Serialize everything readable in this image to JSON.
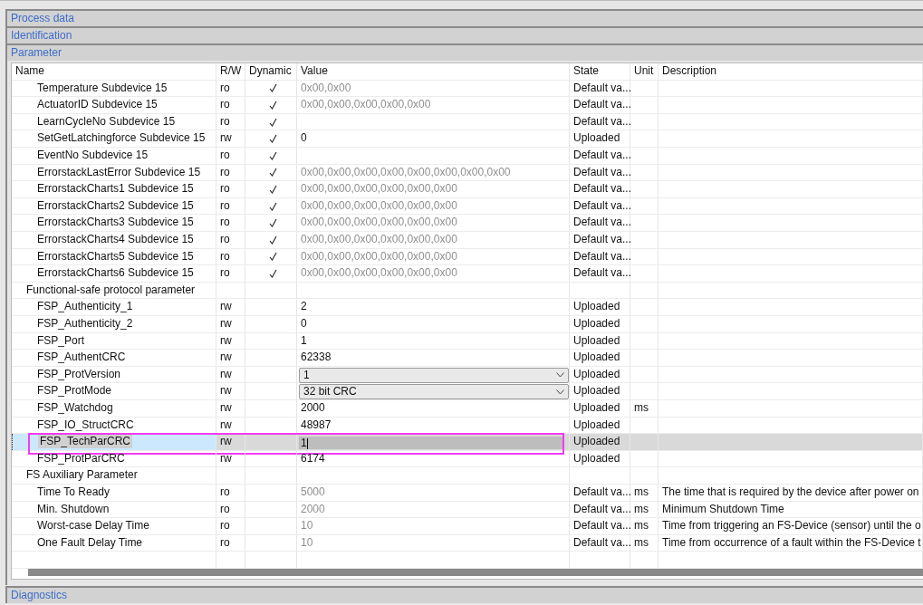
{
  "sections_top": [
    {
      "title": "Process data"
    },
    {
      "title": "Identification"
    },
    {
      "title": "Parameter"
    }
  ],
  "table": {
    "columns": [
      "Name",
      "R/W",
      "Dynamic",
      "Value",
      "State",
      "Unit",
      "Description"
    ],
    "rows": [
      {
        "kind": "param",
        "name": "Temperature Subdevice 15",
        "rw": "ro",
        "dynamic": true,
        "value": {
          "kind": "text",
          "text": "0x00,0x00"
        },
        "greyed": true,
        "state": "Default va...",
        "selected": false,
        "highlighted": false
      },
      {
        "kind": "param",
        "name": "ActuatorID Subdevice 15",
        "rw": "ro",
        "dynamic": true,
        "value": {
          "kind": "text",
          "text": "0x00,0x00,0x00,0x00,0x00"
        },
        "greyed": true,
        "state": "Default va...",
        "selected": false,
        "highlighted": false
      },
      {
        "kind": "param",
        "name": "LearnCycleNo Subdevice 15",
        "rw": "ro",
        "dynamic": true,
        "greyed": true,
        "state": "Default va...",
        "selected": false,
        "highlighted": false
      },
      {
        "kind": "param",
        "name": "SetGetLatchingforce Subdevice 15",
        "rw": "rw",
        "dynamic": true,
        "value": {
          "kind": "text",
          "text": "0"
        },
        "greyed": false,
        "state": "Uploaded",
        "selected": false,
        "highlighted": false
      },
      {
        "kind": "param",
        "name": "EventNo Subdevice 15",
        "rw": "ro",
        "dynamic": true,
        "greyed": true,
        "state": "Default va...",
        "selected": false,
        "highlighted": false
      },
      {
        "kind": "param",
        "name": "ErrorstackLastError Subdevice 15",
        "rw": "ro",
        "dynamic": true,
        "value": {
          "kind": "text",
          "text": "0x00,0x00,0x00,0x00,0x00,0x00,0x00,0x00"
        },
        "greyed": true,
        "state": "Default va...",
        "selected": false,
        "highlighted": false
      },
      {
        "kind": "param",
        "name": "ErrorstackCharts1 Subdevice 15",
        "rw": "ro",
        "dynamic": true,
        "value": {
          "kind": "text",
          "text": "0x00,0x00,0x00,0x00,0x00,0x00"
        },
        "greyed": true,
        "state": "Default va...",
        "selected": false,
        "highlighted": false
      },
      {
        "kind": "param",
        "name": "ErrorstackCharts2 Subdevice 15",
        "rw": "ro",
        "dynamic": true,
        "value": {
          "kind": "text",
          "text": "0x00,0x00,0x00,0x00,0x00,0x00"
        },
        "greyed": true,
        "state": "Default va...",
        "selected": false,
        "highlighted": false
      },
      {
        "kind": "param",
        "name": "ErrorstackCharts3 Subdevice 15",
        "rw": "ro",
        "dynamic": true,
        "value": {
          "kind": "text",
          "text": "0x00,0x00,0x00,0x00,0x00,0x00"
        },
        "greyed": true,
        "state": "Default va...",
        "selected": false,
        "highlighted": false
      },
      {
        "kind": "param",
        "name": "ErrorstackCharts4 Subdevice 15",
        "rw": "ro",
        "dynamic": true,
        "value": {
          "kind": "text",
          "text": "0x00,0x00,0x00,0x00,0x00,0x00"
        },
        "greyed": true,
        "state": "Default va...",
        "selected": false,
        "highlighted": false
      },
      {
        "kind": "param",
        "name": "ErrorstackCharts5 Subdevice 15",
        "rw": "ro",
        "dynamic": true,
        "value": {
          "kind": "text",
          "text": "0x00,0x00,0x00,0x00,0x00,0x00"
        },
        "greyed": true,
        "state": "Default va...",
        "selected": false,
        "highlighted": false
      },
      {
        "kind": "param",
        "name": "ErrorstackCharts6 Subdevice 15",
        "rw": "ro",
        "dynamic": true,
        "value": {
          "kind": "text",
          "text": "0x00,0x00,0x00,0x00,0x00,0x00"
        },
        "greyed": true,
        "state": "Default va...",
        "selected": false,
        "highlighted": false
      },
      {
        "kind": "group",
        "name": "Functional-safe protocol parameter"
      },
      {
        "kind": "param",
        "name": "FSP_Authenticity_1",
        "rw": "rw",
        "dynamic": false,
        "value": {
          "kind": "text",
          "text": "2"
        },
        "greyed": false,
        "state": "Uploaded",
        "selected": false,
        "highlighted": false
      },
      {
        "kind": "param",
        "name": "FSP_Authenticity_2",
        "rw": "rw",
        "dynamic": false,
        "value": {
          "kind": "text",
          "text": "0"
        },
        "greyed": false,
        "state": "Uploaded",
        "selected": false,
        "highlighted": false
      },
      {
        "kind": "param",
        "name": "FSP_Port",
        "rw": "rw",
        "dynamic": false,
        "value": {
          "kind": "text",
          "text": "1"
        },
        "greyed": false,
        "state": "Uploaded",
        "selected": false,
        "highlighted": false
      },
      {
        "kind": "param",
        "name": "FSP_AuthentCRC",
        "rw": "rw",
        "dynamic": false,
        "value": {
          "kind": "text",
          "text": "62338"
        },
        "greyed": false,
        "state": "Uploaded",
        "selected": false,
        "highlighted": false
      },
      {
        "kind": "param",
        "name": "FSP_ProtVersion",
        "rw": "rw",
        "dynamic": false,
        "value": {
          "kind": "dropdown",
          "text": "1"
        },
        "greyed": false,
        "state": "Uploaded",
        "selected": false,
        "highlighted": false
      },
      {
        "kind": "param",
        "name": "FSP_ProtMode",
        "rw": "rw",
        "dynamic": false,
        "value": {
          "kind": "dropdown",
          "text": "32 bit CRC"
        },
        "greyed": false,
        "state": "Uploaded",
        "selected": false,
        "highlighted": false
      },
      {
        "kind": "param",
        "name": "FSP_Watchdog",
        "rw": "rw",
        "dynamic": false,
        "value": {
          "kind": "text",
          "text": "2000"
        },
        "greyed": false,
        "state": "Uploaded",
        "unit": "ms",
        "selected": false,
        "highlighted": false
      },
      {
        "kind": "param",
        "name": "FSP_IO_StructCRC",
        "rw": "rw",
        "dynamic": false,
        "value": {
          "kind": "text",
          "text": "48987"
        },
        "greyed": false,
        "state": "Uploaded",
        "selected": false,
        "highlighted": false
      },
      {
        "kind": "param",
        "name": "FSP_TechParCRC",
        "rw": "rw",
        "dynamic": false,
        "value": {
          "kind": "edit",
          "text": "1"
        },
        "greyed": false,
        "state": "Uploaded",
        "selected": true,
        "highlighted": true
      },
      {
        "kind": "param",
        "name": "FSP_ProtParCRC",
        "rw": "rw",
        "dynamic": false,
        "value": {
          "kind": "text",
          "text": "6174"
        },
        "greyed": false,
        "state": "Uploaded",
        "selected": false,
        "highlighted": false
      },
      {
        "kind": "group",
        "name": "FS Auxiliary Parameter"
      },
      {
        "kind": "param",
        "name": "Time To Ready",
        "rw": "ro",
        "dynamic": false,
        "value": {
          "kind": "text",
          "text": "5000"
        },
        "greyed": true,
        "state": "Default va...",
        "unit": "ms",
        "description": "The time that is required by the device after power on",
        "selected": false,
        "highlighted": false
      },
      {
        "kind": "param",
        "name": "Min. Shutdown",
        "rw": "ro",
        "dynamic": false,
        "value": {
          "kind": "text",
          "text": "2000"
        },
        "greyed": true,
        "state": "Default va...",
        "unit": "ms",
        "description": "Minimum Shutdown Time",
        "selected": false,
        "highlighted": false
      },
      {
        "kind": "param",
        "name": "Worst-case Delay Time",
        "rw": "ro",
        "dynamic": false,
        "value": {
          "kind": "text",
          "text": "10"
        },
        "greyed": true,
        "state": "Default va...",
        "unit": "ms",
        "description": "Time from triggering an FS-Device (sensor) until the o",
        "selected": false,
        "highlighted": false
      },
      {
        "kind": "param",
        "name": "One Fault Delay Time",
        "rw": "ro",
        "dynamic": false,
        "value": {
          "kind": "text",
          "text": "10"
        },
        "greyed": true,
        "state": "Default va...",
        "unit": "ms",
        "description": "Time from occurrence of a fault within the FS-Device t",
        "selected": false,
        "highlighted": false
      }
    ]
  },
  "sections_bottom": [
    {
      "title": "Diagnostics"
    }
  ]
}
